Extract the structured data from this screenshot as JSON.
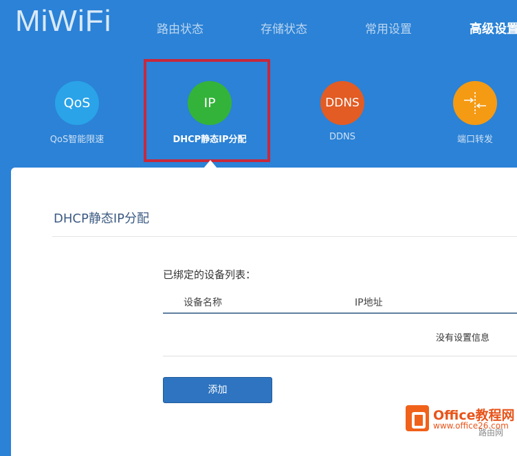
{
  "header": {
    "logo": "MiWiFi",
    "nav": [
      "路由状态",
      "存储状态",
      "常用设置",
      "高级设置"
    ],
    "active_nav": "高级设置"
  },
  "apps": [
    {
      "icon_text": "QoS",
      "label": "QoS智能限速",
      "color": "#2aa3e8",
      "icon": "qos-icon"
    },
    {
      "icon_text": "IP",
      "label": "DHCP静态IP分配",
      "color": "#33b33a",
      "icon": "ip-icon",
      "active": true
    },
    {
      "icon_text": "DDNS",
      "label": "DDNS",
      "color": "#e25c24",
      "icon": "ddns-icon"
    },
    {
      "icon_text": "",
      "label": "端口转发",
      "color": "#f59a13",
      "icon": "port-forward-icon"
    }
  ],
  "panel": {
    "title": "DHCP静态IP分配",
    "list_title": "已绑定的设备列表：",
    "columns": [
      "设备名称",
      "IP地址"
    ],
    "empty_message": "没有设置信息",
    "add_button": "添加"
  },
  "watermark": {
    "brand": "Office教程网",
    "url": "www.office26.com",
    "site": "路由网"
  }
}
